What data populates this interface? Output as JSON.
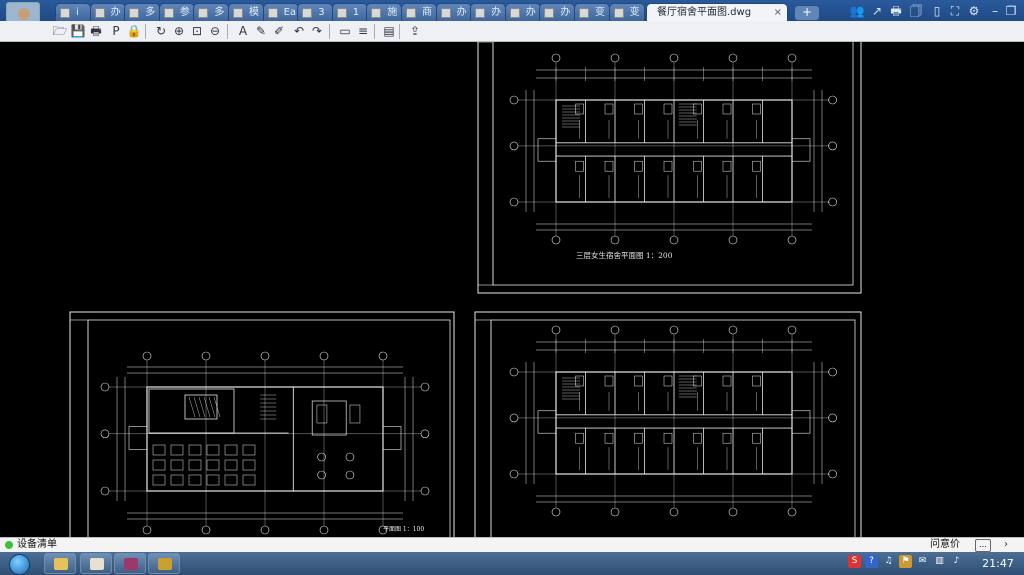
{
  "tabs": [
    {
      "label": "i"
    },
    {
      "label": "办"
    },
    {
      "label": "多"
    },
    {
      "label": "参"
    },
    {
      "label": "多"
    },
    {
      "label": "模"
    },
    {
      "label": "Ea"
    },
    {
      "label": "3"
    },
    {
      "label": "1"
    },
    {
      "label": "施"
    },
    {
      "label": "商"
    },
    {
      "label": "办"
    },
    {
      "label": "办"
    },
    {
      "label": "办"
    },
    {
      "label": "办"
    },
    {
      "label": "变"
    },
    {
      "label": "变"
    }
  ],
  "active_tab": {
    "label": "餐厅宿舍平面图.dwg"
  },
  "new_tab": {
    "label": "+"
  },
  "window_buttons": [
    "👥",
    "↗",
    "🖶",
    "🗍",
    "▯",
    "⛶",
    "⚙",
    "–",
    "❐",
    "✕"
  ],
  "toolbar": {
    "icons": [
      "open-icon",
      "save-icon",
      "print-icon",
      "pdf-icon",
      "lock-icon",
      "rotate-icon",
      "zoom-in-icon",
      "zoom-window-icon",
      "zoom-out-icon",
      "text-icon",
      "pencil-icon",
      "markup-icon",
      "undo-icon",
      "redo-icon",
      "layer-line-icon",
      "layer-stack-icon",
      "layers-icon",
      "export-icon"
    ],
    "glyphs": [
      "🗁",
      "💾",
      "🖶",
      "P",
      "🔒",
      "↻",
      "⊕",
      "⊡",
      "⊖",
      "A",
      "✎",
      "✐",
      "↶",
      "↷",
      "▭",
      "≡",
      "▤",
      "⇪"
    ]
  },
  "drawing": {
    "panels": [
      {
        "caption": "三层女生宿舍平面图 1：200"
      },
      {
        "caption": "平面图 1：100"
      },
      {
        "caption": ""
      }
    ]
  },
  "status": {
    "label": "设备清单",
    "feedback": "问意价",
    "chat": "…",
    "more": "›"
  },
  "taskbar": {
    "tasks": [
      {
        "name": "explorer",
        "color": "#e6c25a"
      },
      {
        "name": "user",
        "color": "#e8e0d0"
      },
      {
        "name": "winrar",
        "color": "#9b3a6a"
      },
      {
        "name": "viewer",
        "color": "#c8a030"
      }
    ],
    "tray": [
      "S",
      "?",
      "♫",
      "⚑",
      "✉",
      "▥",
      "♪"
    ],
    "clock": "21:47"
  },
  "colors": {
    "cad_line": "#e8e8e8",
    "tab_active": "#f2f4f7",
    "taskbar": "#3a5a80"
  }
}
